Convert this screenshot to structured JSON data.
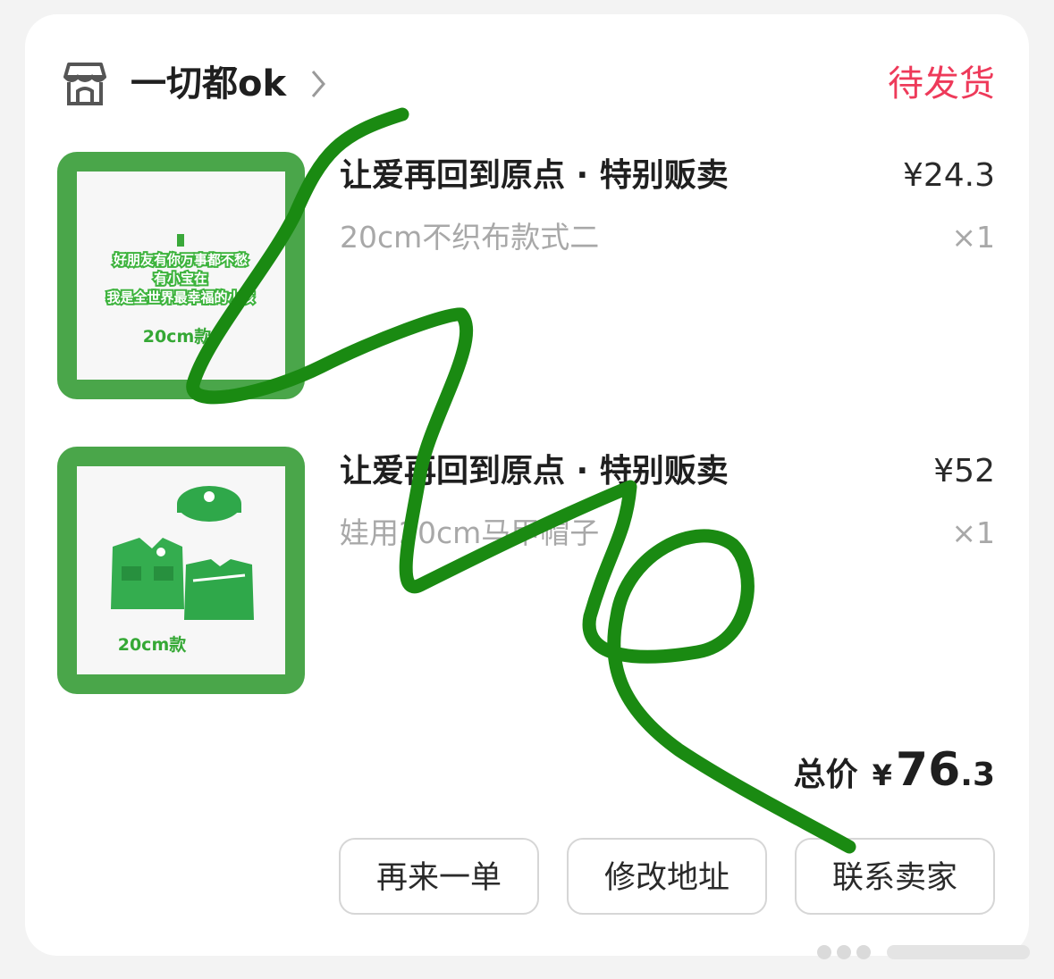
{
  "shop": {
    "name": "一切都ok",
    "icon": "shop-icon",
    "status": "待发货",
    "status_color": "#ee3a5a"
  },
  "items": [
    {
      "title": "让爱再回到原点 · 特别贩卖",
      "spec": "20cm不织布款式二",
      "price": "¥24.3",
      "qty": "×1",
      "thumb_text": [
        "好朋友有你万事都不愁",
        "有小宝在",
        "我是全世界最幸福的小孩",
        "20cm款"
      ]
    },
    {
      "title": "让爱再回到原点 · 特别贩卖",
      "spec": "娃用20cm马甲帽子",
      "price": "¥52",
      "qty": "×1",
      "thumb_text": [
        "20cm款"
      ]
    }
  ],
  "total": {
    "label": "总价",
    "currency": "¥",
    "integer": "76",
    "decimal": ".3"
  },
  "buttons": {
    "reorder": "再来一单",
    "edit_address": "修改地址",
    "contact_seller": "联系卖家"
  },
  "colors": {
    "thumb_border": "#4aa64a",
    "scribble": "#1a8a12"
  }
}
